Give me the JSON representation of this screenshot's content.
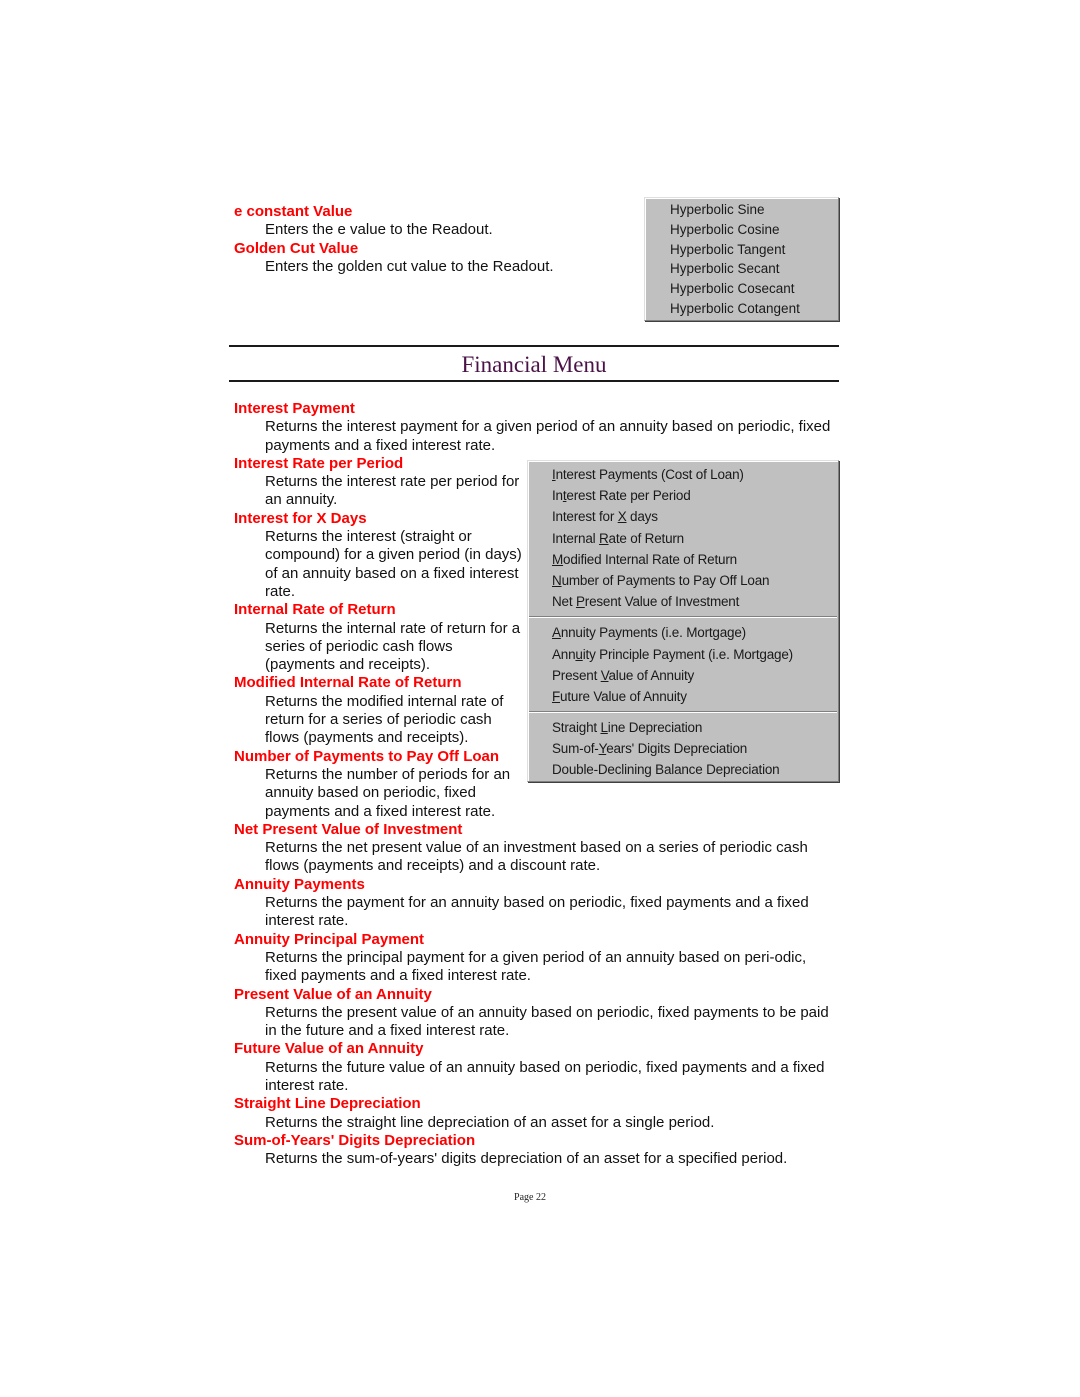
{
  "top_definitions": [
    {
      "term": "e constant Value",
      "description": "Enters the e value to the Readout."
    },
    {
      "term": "Golden Cut Value",
      "description": "Enters the golden cut value to the Readout."
    }
  ],
  "hyperbolic_menu": {
    "items": [
      {
        "label": "Hyperbolic Sine"
      },
      {
        "label": "Hyperbolic Cosine"
      },
      {
        "label": "Hyperbolic Tangent"
      },
      {
        "label": "Hyperbolic Secant"
      },
      {
        "label": "Hyperbolic Cosecant"
      },
      {
        "label": "Hyperbolic Cotangent"
      }
    ]
  },
  "section": {
    "title": "Financial Menu"
  },
  "financial_definitions": [
    {
      "term": "Interest Payment",
      "description": "Returns the interest payment for a given period of an annuity based on periodic, fixed payments and a fixed interest rate."
    },
    {
      "term": "Interest Rate per Period",
      "description": "Returns the interest rate per period for an annuity."
    },
    {
      "term": "Interest for X Days",
      "description": "Returns the interest (straight or compound) for a given period (in days) of an annuity based on a fixed interest rate."
    },
    {
      "term": "Internal Rate of Return",
      "description": "Returns the internal rate of return for a series of periodic cash flows (payments and receipts)."
    },
    {
      "term": "Modified Internal Rate of Return",
      "description": "Returns the modified internal rate of return for a series of periodic cash flows (payments and receipts)."
    },
    {
      "term": "Number of Payments to Pay Off Loan",
      "description": "Returns the number of periods for an annuity based on periodic, fixed payments and a fixed interest rate."
    },
    {
      "term": "Net Present Value of Investment",
      "description": "Returns the net present value of an investment based on a series of periodic cash flows (payments and receipts) and a discount rate."
    },
    {
      "term": "Annuity Payments",
      "description": "Returns the payment for an annuity based on periodic, fixed payments and a fixed interest rate."
    },
    {
      "term": "Annuity Principal Payment",
      "description": "Returns the principal payment for a given period of an annuity based on peri-odic, fixed payments and a fixed interest rate."
    },
    {
      "term": "Present Value of an Annuity",
      "description": "Returns the present value of an annuity based on periodic, fixed payments to be paid in the future and a fixed interest rate."
    },
    {
      "term": "Future Value of an Annuity",
      "description": "Returns the future value of an annuity based on periodic, fixed payments and a fixed interest rate."
    },
    {
      "term": "Straight Line Depreciation",
      "description": "Returns the straight line depreciation of an asset for a single period."
    },
    {
      "term": "Sum-of-Years' Digits Depreciation",
      "description": "Returns the sum-of-years' digits depreciation of an asset for a specified period."
    }
  ],
  "financial_menu": {
    "groups": [
      {
        "items": [
          {
            "pre": "",
            "key": "I",
            "post": "nterest Payments (Cost of Loan)"
          },
          {
            "pre": "In",
            "key": "t",
            "post": "erest Rate per Period"
          },
          {
            "pre": "Interest for ",
            "key": "X",
            "post": " days"
          },
          {
            "pre": "Internal ",
            "key": "R",
            "post": "ate of Return"
          },
          {
            "pre": "",
            "key": "M",
            "post": "odified Internal Rate of Return"
          },
          {
            "pre": "",
            "key": "N",
            "post": "umber of Payments to Pay Off Loan"
          },
          {
            "pre": "Net ",
            "key": "P",
            "post": "resent Value of Investment"
          }
        ]
      },
      {
        "items": [
          {
            "pre": "",
            "key": "A",
            "post": "nnuity Payments (i.e. Mortgage)"
          },
          {
            "pre": "Ann",
            "key": "u",
            "post": "ity Principle Payment (i.e. Mortgage)"
          },
          {
            "pre": "Present ",
            "key": "V",
            "post": "alue of Annuity"
          },
          {
            "pre": "",
            "key": "F",
            "post": "uture Value of Annuity"
          }
        ]
      },
      {
        "items": [
          {
            "pre": "Straight ",
            "key": "L",
            "post": "ine Depreciation"
          },
          {
            "pre": "Sum-of-",
            "key": "Y",
            "post": "ears' Digits Depreciation"
          },
          {
            "pre": "Double-Declining Balance Depreciation",
            "key": "",
            "post": ""
          }
        ]
      }
    ]
  },
  "footer": {
    "page_label": "Page 22"
  },
  "colors": {
    "term": "#ff0000",
    "title": "#4b1248",
    "menu_bg": "#c0c0c0"
  }
}
